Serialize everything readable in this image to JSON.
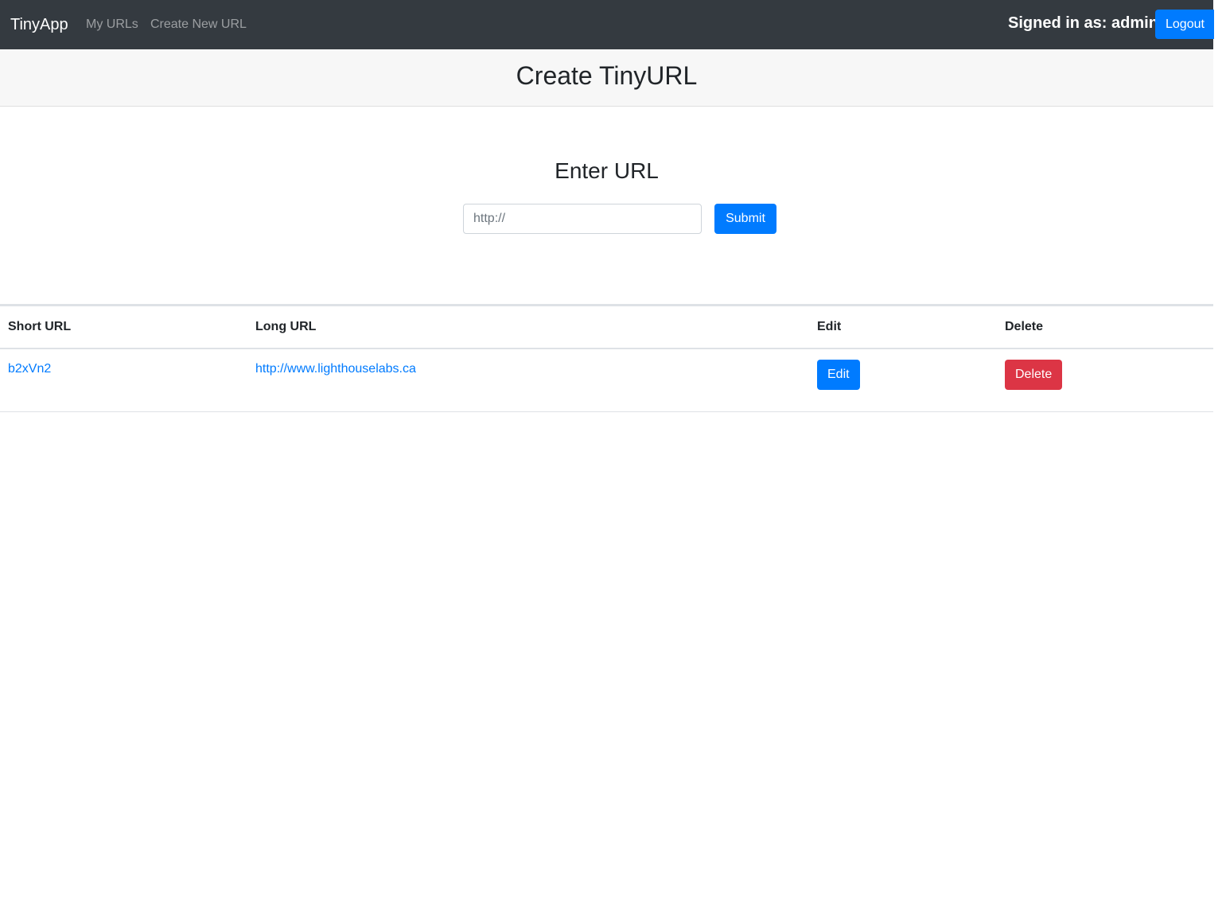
{
  "navbar": {
    "brand": "TinyApp",
    "links": [
      {
        "label": "My URLs"
      },
      {
        "label": "Create New URL"
      }
    ],
    "signed_in_label": "Signed in as:",
    "username": "admin",
    "logout_label": "Logout"
  },
  "header": {
    "title": "Create TinyURL"
  },
  "form": {
    "title": "Enter URL",
    "input_placeholder": "http://",
    "input_value": "",
    "submit_label": "Submit"
  },
  "table": {
    "headers": [
      "Short URL",
      "Long URL",
      "Edit",
      "Delete"
    ],
    "rows": [
      {
        "short_url": "b2xVn2",
        "long_url": "http://www.lighthouselabs.ca",
        "edit_label": "Edit",
        "delete_label": "Delete"
      }
    ]
  },
  "colors": {
    "navbar_bg": "#343a40",
    "primary": "#007bff",
    "danger": "#dc3545",
    "header_bg": "#f7f7f7"
  }
}
